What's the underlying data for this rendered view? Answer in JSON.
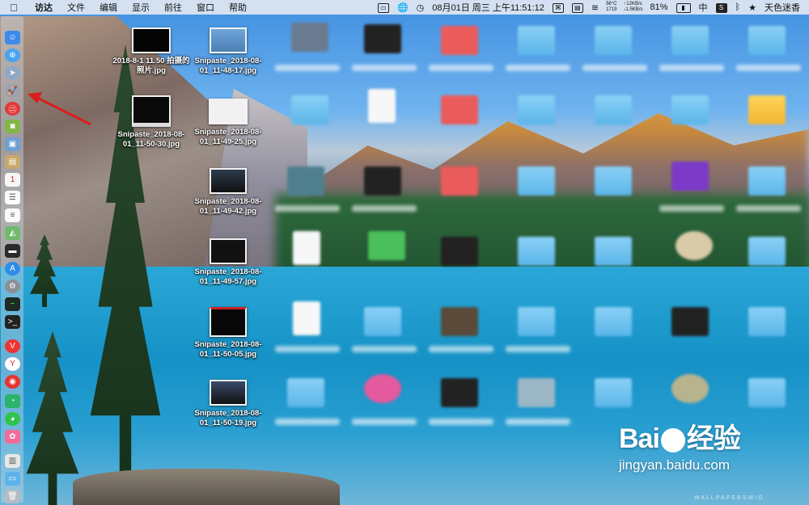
{
  "menubar": {
    "apple": "",
    "items": [
      "访达",
      "文件",
      "编辑",
      "显示",
      "前往",
      "窗口",
      "帮助"
    ],
    "active_app": "访达",
    "status": {
      "date_time": "08月01日 周三 上午11:51:12",
      "cpu_temp": "56°C",
      "cpu_temp2": "1719",
      "net_up": "↑12KB/s",
      "net_down": "↓1.5KB/s",
      "battery": "81%",
      "input_method": "中",
      "user": "天色迷香"
    }
  },
  "desktop_files": [
    {
      "name": "2018-8-1 11.50 拍摄的照片.jpg"
    },
    {
      "name": "Snipaste_2018-08-01_11-48-17.jpg"
    },
    {
      "name": "Snipaste_2018-08-01_11-50-30.jpg"
    },
    {
      "name": "Snipaste_2018-08-01_11-49-25.jpg"
    },
    {
      "name": "Snipaste_2018-08-01_11-49-42.jpg"
    },
    {
      "name": "Snipaste_2018-08-01_11-49-57.jpg"
    },
    {
      "name": "Snipaste_2018-08-01_11-50-05.jpg"
    },
    {
      "name": "Snipaste_2018-08-01_11-50-19.jpg"
    }
  ],
  "watermark": {
    "logo_left": "Bai",
    "logo_right": "经验",
    "url": "jingyan.baidu.com",
    "wallpaper_credit": "WALLPAPERSWID"
  },
  "dock_icons": [
    "finder-icon",
    "safari-icon",
    "compass-icon",
    "launchpad-icon",
    "red-app-icon",
    "android-icon",
    "preview-icon",
    "notes-icon",
    "calendar-icon",
    "reminders-icon",
    "maps-icon",
    "terminal-icon",
    "appstore-icon",
    "system-prefs-icon",
    "activity-monitor-icon",
    "console-icon",
    "vivaldi-icon",
    "yandex-icon",
    "weibo-icon",
    "green-app-icon",
    "wechat-icon",
    "photos-icon",
    "documents-icon",
    "folder-icon",
    "trash-icon"
  ]
}
